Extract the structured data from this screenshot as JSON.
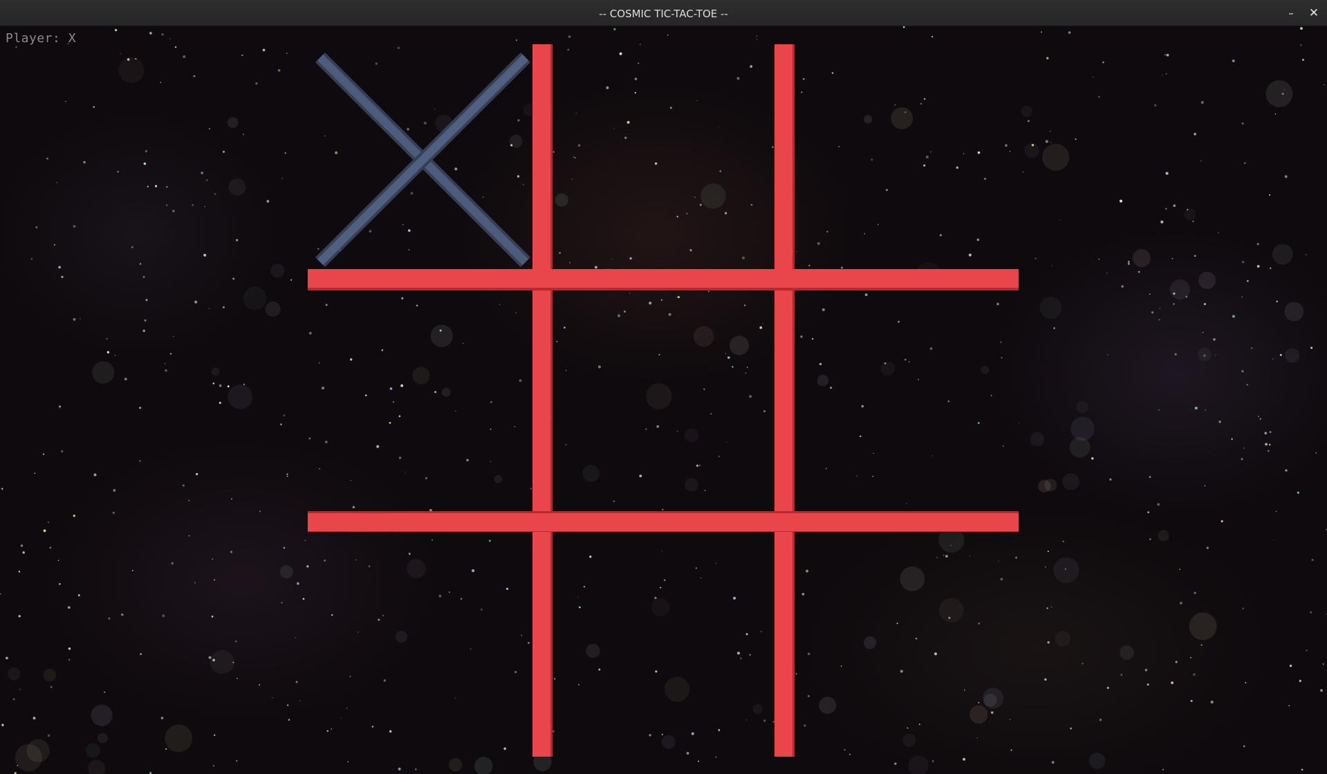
{
  "window": {
    "title": "-- COSMIC TIC-TAC-TOE --",
    "minimize_glyph": "–",
    "close_glyph": "✕"
  },
  "hud": {
    "player_label": "Player: X"
  },
  "board": {
    "line_color": "#e8464b",
    "x_mark_color": "#4a5a78",
    "cells": [
      "X",
      "",
      "",
      "",
      "",
      "",
      "",
      "",
      ""
    ]
  },
  "colors": {
    "titlebar": "#2b2b2b",
    "space_background": "#0e0a0d",
    "hud_text": "#8c8c8c"
  }
}
